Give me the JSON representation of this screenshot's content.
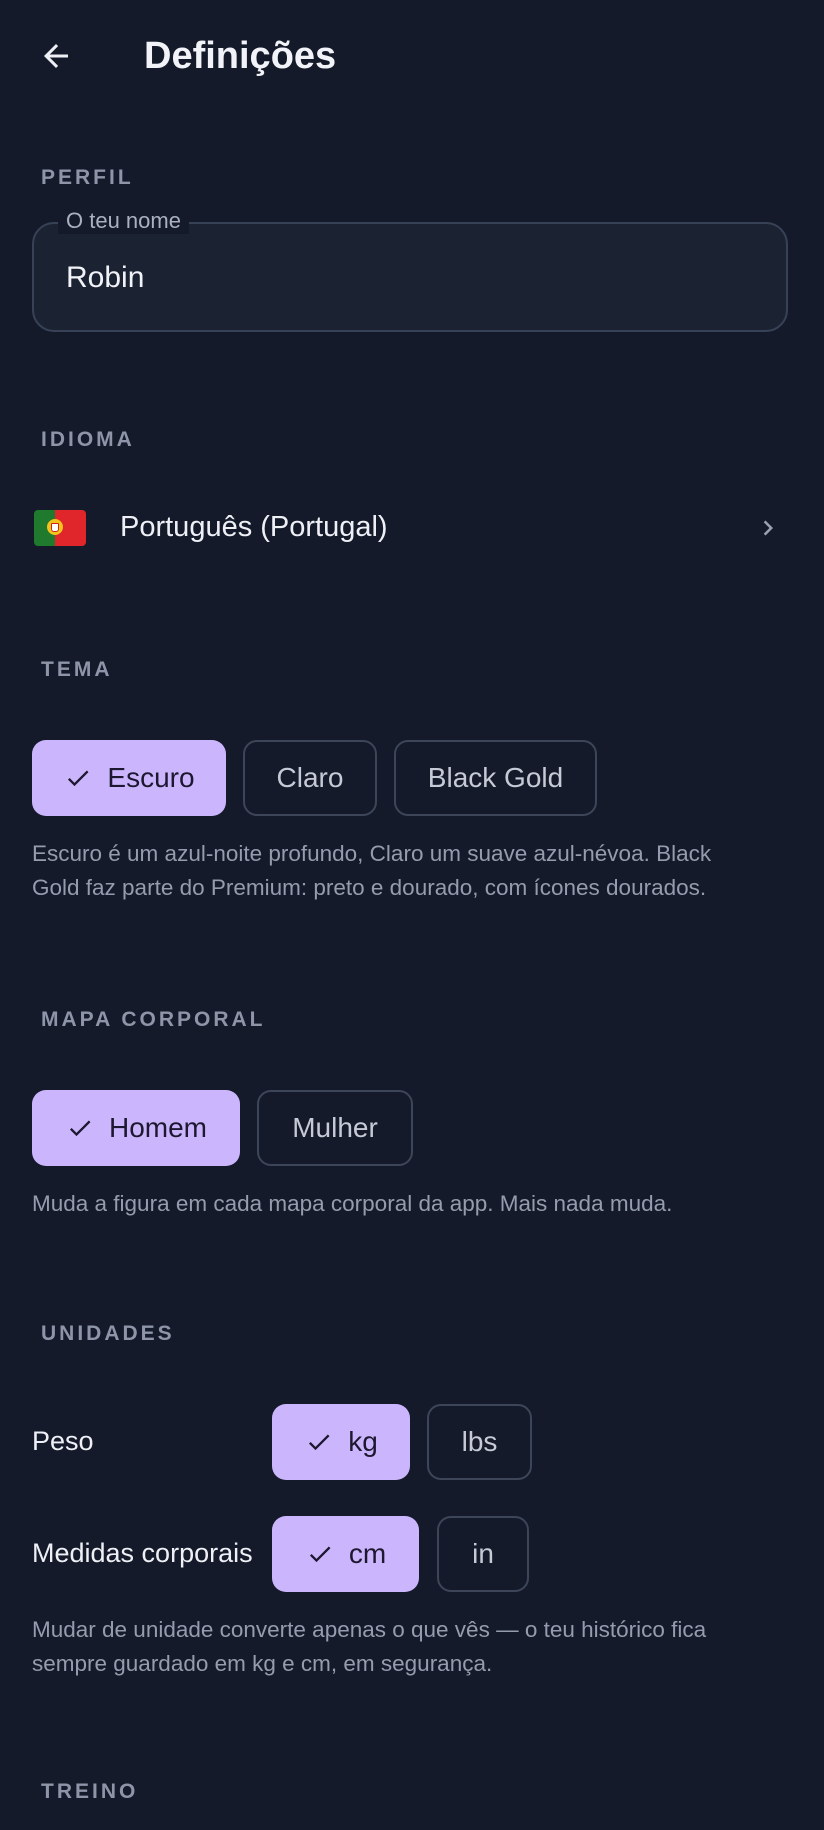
{
  "header": {
    "title": "Definições",
    "back_icon": "arrow-left-icon"
  },
  "profile": {
    "section_label": "PERFIL",
    "name_field": {
      "label": "O teu nome",
      "value": "Robin"
    }
  },
  "language": {
    "section_label": "IDIOMA",
    "flag_icon": "portugal-flag-icon",
    "selected": "Português (Portugal)",
    "chevron_icon": "chevron-right-icon"
  },
  "theme": {
    "section_label": "TEMA",
    "options": [
      {
        "label": "Escuro",
        "selected": true
      },
      {
        "label": "Claro",
        "selected": false
      },
      {
        "label": "Black Gold",
        "selected": false
      }
    ],
    "helper_line1": "Escuro é um azul-noite profundo, Claro um suave azul-névoa. Black",
    "helper_line2": "Gold faz parte do Premium: preto e dourado, com ícones dourados."
  },
  "body_map": {
    "section_label": "MAPA CORPORAL",
    "options": [
      {
        "label": "Homem",
        "selected": true
      },
      {
        "label": "Mulher",
        "selected": false
      }
    ],
    "helper": "Muda a figura em cada mapa corporal da app. Mais nada muda."
  },
  "units": {
    "section_label": "UNIDADES",
    "weight": {
      "label": "Peso",
      "options": [
        {
          "label": "kg",
          "selected": true
        },
        {
          "label": "lbs",
          "selected": false
        }
      ]
    },
    "measurements": {
      "label": "Medidas corporais",
      "options": [
        {
          "label": "cm",
          "selected": true
        },
        {
          "label": "in",
          "selected": false
        }
      ]
    },
    "helper_line1": "Mudar de unidade converte apenas o que vês — o teu histórico fica",
    "helper_line2": "sempre guardado em kg e cm, em segurança."
  },
  "training": {
    "section_label": "TREINO"
  },
  "colors": {
    "background": "#141a29",
    "accent": "#cbb6fd",
    "chip_outline": "#3d4558",
    "muted_text": "#959cad",
    "section_label": "#8e95a8"
  }
}
